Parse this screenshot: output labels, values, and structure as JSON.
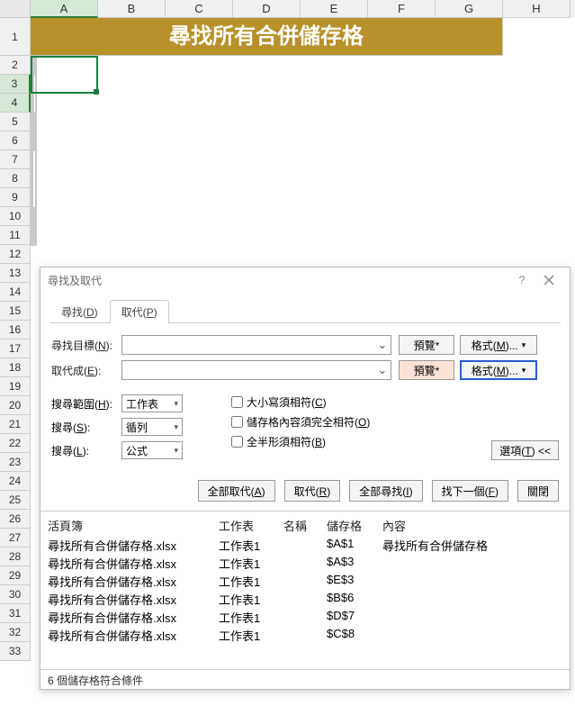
{
  "columns": [
    "A",
    "B",
    "C",
    "D",
    "E",
    "F",
    "G",
    "H"
  ],
  "rows": [
    "1",
    "2",
    "3",
    "4",
    "5",
    "6",
    "7",
    "8",
    "9",
    "10",
    "11",
    "12",
    "13",
    "14",
    "15",
    "16",
    "17",
    "18",
    "19",
    "20",
    "21",
    "22",
    "23",
    "24",
    "25",
    "26",
    "27",
    "28",
    "29",
    "30",
    "31",
    "32",
    "33"
  ],
  "banner": "尋找所有合併儲存格",
  "dialog": {
    "title": "尋找及取代",
    "tabs": {
      "find": "尋找(D)",
      "replace": "取代(P)"
    },
    "findLabel": "尋找目標(N):",
    "replaceLabel": "取代成(E):",
    "previewBtn": "預覽*",
    "formatBtn": "格式(M)...",
    "rangeLabel": "搜尋範圍(H):",
    "rangeValue": "工作表",
    "searchLabel": "搜尋(S):",
    "searchValue": "循列",
    "lookInLabel": "搜尋(L):",
    "lookInValue": "公式",
    "checkCase": "大小寫須相符(C)",
    "checkWhole": "儲存格內容須完全相符(O)",
    "checkWidth": "全半形須相符(B)",
    "optionsBtn": "選項(T) <<",
    "btn": {
      "replaceAll": "全部取代(A)",
      "replace": "取代(R)",
      "findAll": "全部尋找(I)",
      "findNext": "找下一個(F)",
      "close": "關閉"
    }
  },
  "results": {
    "headers": {
      "wb": "活頁簿",
      "ws": "工作表",
      "name": "名稱",
      "cell": "儲存格",
      "content": "內容"
    },
    "rows": [
      {
        "wb": "尋找所有合併儲存格.xlsx",
        "ws": "工作表1",
        "name": "",
        "cell": "$A$1",
        "content": "尋找所有合併儲存格"
      },
      {
        "wb": "尋找所有合併儲存格.xlsx",
        "ws": "工作表1",
        "name": "",
        "cell": "$A$3",
        "content": ""
      },
      {
        "wb": "尋找所有合併儲存格.xlsx",
        "ws": "工作表1",
        "name": "",
        "cell": "$E$3",
        "content": ""
      },
      {
        "wb": "尋找所有合併儲存格.xlsx",
        "ws": "工作表1",
        "name": "",
        "cell": "$B$6",
        "content": ""
      },
      {
        "wb": "尋找所有合併儲存格.xlsx",
        "ws": "工作表1",
        "name": "",
        "cell": "$D$7",
        "content": ""
      },
      {
        "wb": "尋找所有合併儲存格.xlsx",
        "ws": "工作表1",
        "name": "",
        "cell": "$C$8",
        "content": ""
      }
    ]
  },
  "status": "6 個儲存格符合條件"
}
